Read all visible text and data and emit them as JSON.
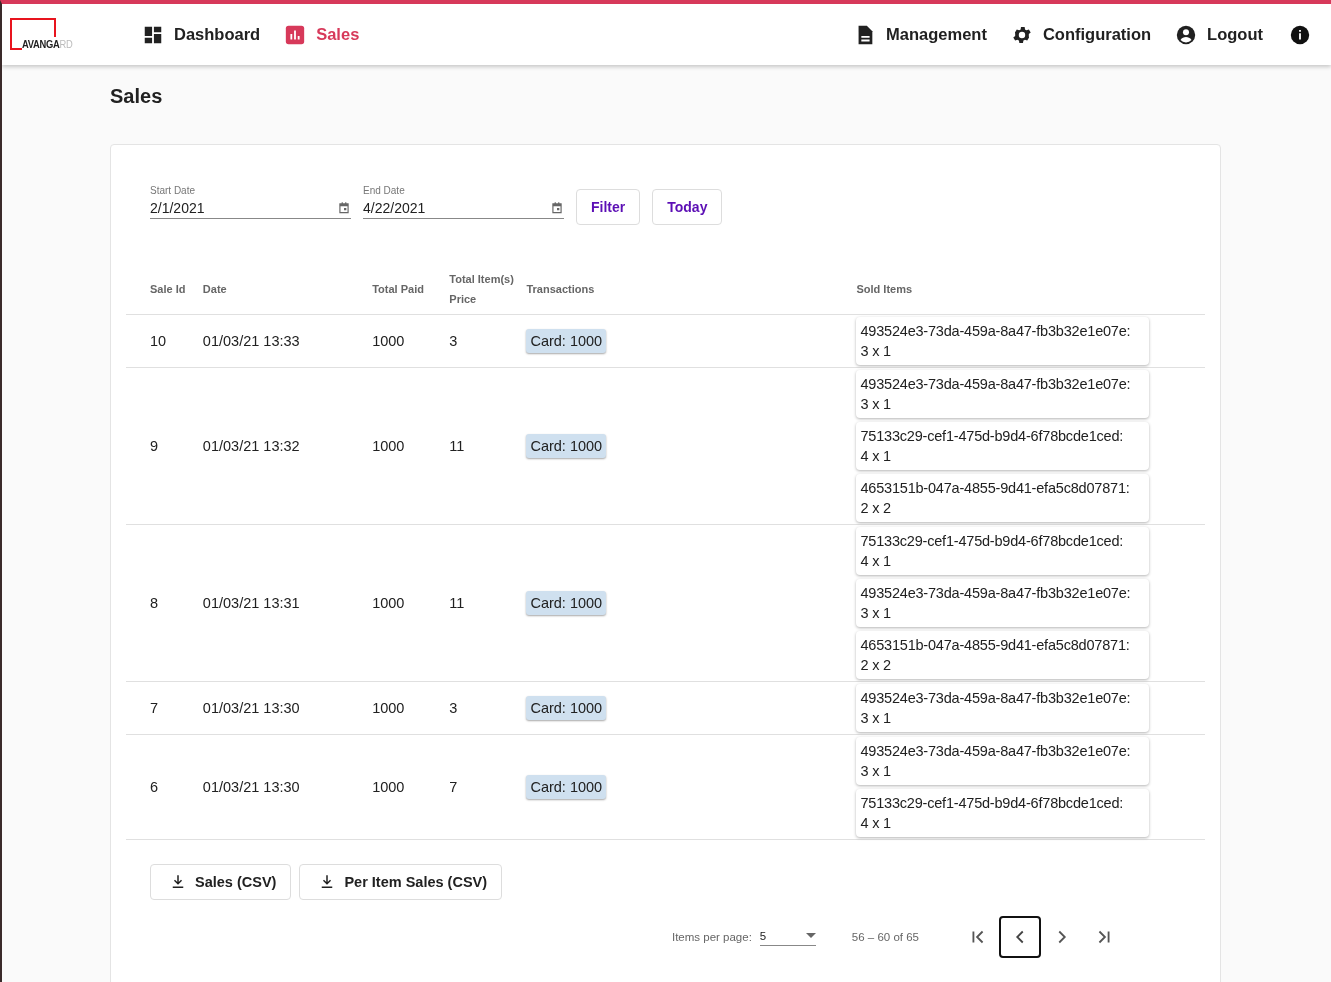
{
  "logo": {
    "dark": "AVANGA",
    "light": "RD"
  },
  "nav": [
    {
      "label": "Dashboard",
      "selected": false
    },
    {
      "label": "Sales",
      "selected": true
    }
  ],
  "nav_right": [
    "Management",
    "Configuration",
    "Logout"
  ],
  "page_title": "Sales",
  "filters": {
    "start": {
      "label": "Start Date",
      "value": "2/1/2021"
    },
    "end": {
      "label": "End Date",
      "value": "4/22/2021"
    },
    "buttons": [
      "Filter",
      "Today"
    ]
  },
  "table": {
    "columns": [
      "Sale Id",
      "Date",
      "Total Paid",
      "Total Item(s) Price",
      "Transactions",
      "Sold Items"
    ],
    "rows": [
      {
        "id": "10",
        "date": "01/03/21 13:33",
        "paid": "1000",
        "items_price": "3",
        "transaction": "Card: 1000",
        "sold": [
          {
            "item": "493524e3-73da-459a-8a47-fb3b32e1e07e:",
            "qty": "3 x 1"
          }
        ]
      },
      {
        "id": "9",
        "date": "01/03/21 13:32",
        "paid": "1000",
        "items_price": "11",
        "transaction": "Card: 1000",
        "sold": [
          {
            "item": "493524e3-73da-459a-8a47-fb3b32e1e07e:",
            "qty": "3 x 1"
          },
          {
            "item": "75133c29-cef1-475d-b9d4-6f78bcde1ced:",
            "qty": "4 x 1"
          },
          {
            "item": "4653151b-047a-4855-9d41-efa5c8d07871:",
            "qty": "2 x 2"
          }
        ]
      },
      {
        "id": "8",
        "date": "01/03/21 13:31",
        "paid": "1000",
        "items_price": "11",
        "transaction": "Card: 1000",
        "sold": [
          {
            "item": "75133c29-cef1-475d-b9d4-6f78bcde1ced:",
            "qty": "4 x 1"
          },
          {
            "item": "493524e3-73da-459a-8a47-fb3b32e1e07e:",
            "qty": "3 x 1"
          },
          {
            "item": "4653151b-047a-4855-9d41-efa5c8d07871:",
            "qty": "2 x 2"
          }
        ]
      },
      {
        "id": "7",
        "date": "01/03/21 13:30",
        "paid": "1000",
        "items_price": "3",
        "transaction": "Card: 1000",
        "sold": [
          {
            "item": "493524e3-73da-459a-8a47-fb3b32e1e07e:",
            "qty": "3 x 1"
          }
        ]
      },
      {
        "id": "6",
        "date": "01/03/21 13:30",
        "paid": "1000",
        "items_price": "7",
        "transaction": "Card: 1000",
        "sold": [
          {
            "item": "493524e3-73da-459a-8a47-fb3b32e1e07e:",
            "qty": "3 x 1"
          },
          {
            "item": "75133c29-cef1-475d-b9d4-6f78bcde1ced:",
            "qty": "4 x 1"
          }
        ]
      }
    ]
  },
  "exports": [
    "Sales (CSV)",
    "Per Item Sales (CSV)"
  ],
  "paginator": {
    "label": "Items per page:",
    "page_size": "5",
    "range": "56 – 60 of 65",
    "buttons": [
      {
        "kind": "first",
        "focused": false
      },
      {
        "kind": "prev",
        "focused": true
      },
      {
        "kind": "next",
        "focused": false
      },
      {
        "kind": "last",
        "focused": false
      }
    ]
  }
}
